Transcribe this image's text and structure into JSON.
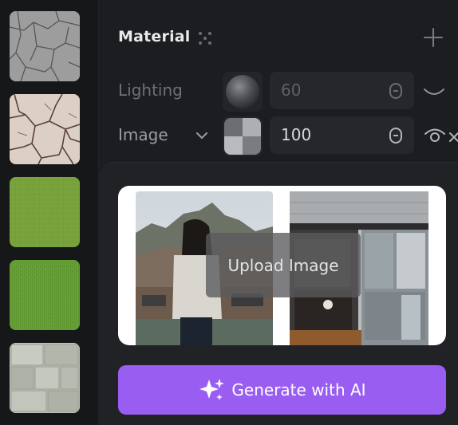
{
  "textures": [
    {
      "name": "cracked-stone",
      "color": "#9b9c9b"
    },
    {
      "name": "cracked-marble",
      "color": "#d8cdc4"
    },
    {
      "name": "grass-light",
      "color": "#7ba63e"
    },
    {
      "name": "grass-dark",
      "color": "#6da337"
    },
    {
      "name": "stone-tiles",
      "color": "#b9bdb3"
    }
  ],
  "panel": {
    "title": "Material",
    "icons": {
      "grip": "grip-dots-icon",
      "add": "plus-icon"
    },
    "lighting": {
      "label": "Lighting",
      "value": "60"
    },
    "image": {
      "label": "Image",
      "value": "100"
    }
  },
  "upload": {
    "label": "Upload Image",
    "generate_label": "Generate with AI"
  },
  "colors": {
    "background": "#1b1c1f",
    "accent": "#9a5df2",
    "muted_text": "#6f7075"
  }
}
